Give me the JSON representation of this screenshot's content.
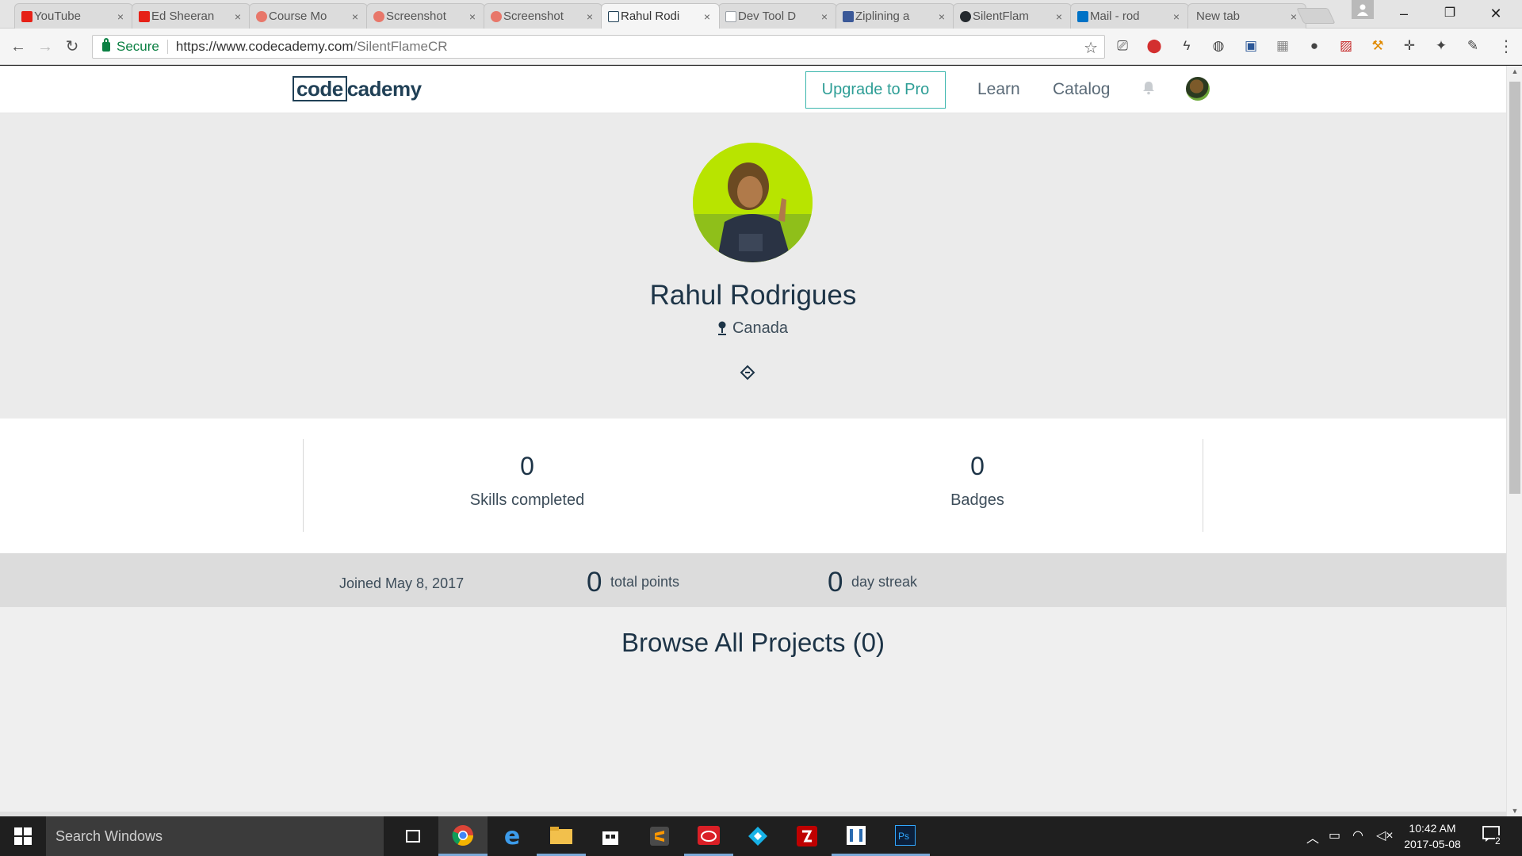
{
  "browser": {
    "tabs": [
      {
        "label": "YouTube",
        "favicon_color": "#e62117"
      },
      {
        "label": "Ed Sheeran",
        "favicon_color": "#e62117"
      },
      {
        "label": "Course Mo",
        "favicon_color": "#e8776a"
      },
      {
        "label": "Screenshot",
        "favicon_color": "#e8776a"
      },
      {
        "label": "Screenshot",
        "favicon_color": "#e8776a"
      },
      {
        "label": "Rahul Rodi",
        "favicon_color": "#204056",
        "active": true
      },
      {
        "label": "Dev Tool D",
        "favicon_color": "#9aa0a6"
      },
      {
        "label": "Ziplining a",
        "favicon_color": "#3b5998"
      },
      {
        "label": "SilentFlam",
        "favicon_color": "#24292e"
      },
      {
        "label": "Mail - rod",
        "favicon_color": "#0072c6"
      },
      {
        "label": "New tab",
        "favicon_color": ""
      }
    ],
    "close_glyph": "×",
    "window_controls": {
      "minimize": "–",
      "restore": "❐",
      "close": "✕"
    },
    "address": {
      "secure_label": "Secure",
      "url_host": "https://www.codecademy.com",
      "url_path": "/SilentFlameCR"
    }
  },
  "site": {
    "logo_part1": "code",
    "logo_part2": "cademy",
    "upgrade_label": "Upgrade to Pro",
    "nav_learn": "Learn",
    "nav_catalog": "Catalog"
  },
  "profile": {
    "name": "Rahul Rodrigues",
    "location": "Canada",
    "skills_count": "0",
    "skills_label": "Skills completed",
    "badges_count": "0",
    "badges_label": "Badges",
    "joined": "Joined May 8, 2017",
    "total_points": "0",
    "total_points_label": "total points",
    "day_streak": "0",
    "day_streak_label": "day streak",
    "browse_title": "Browse All Projects (0)"
  },
  "taskbar": {
    "search_placeholder": "Search Windows",
    "time": "10:42 AM",
    "date": "2017-05-08",
    "notification_count": "2"
  },
  "colors": {
    "brand_navy": "#204056",
    "accent_teal": "#3bb6ad",
    "secure_green": "#0b8043"
  }
}
